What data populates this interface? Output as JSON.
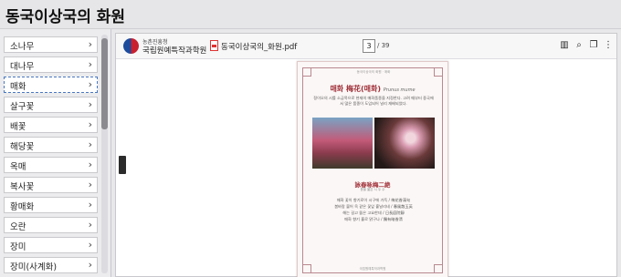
{
  "window": {
    "title": "동국이상국의 화원"
  },
  "sidebar": {
    "items": [
      {
        "label": "소나무"
      },
      {
        "label": "대나무"
      },
      {
        "label": "매화"
      },
      {
        "label": "살구꽃"
      },
      {
        "label": "배꽃"
      },
      {
        "label": "해당꽃"
      },
      {
        "label": "옥매"
      },
      {
        "label": "복사꽃"
      },
      {
        "label": "황매화"
      },
      {
        "label": "오란"
      },
      {
        "label": "장미"
      },
      {
        "label": "장미(사계화)"
      }
    ],
    "selected_index": 2,
    "chevron": "›"
  },
  "viewer": {
    "org_small": "농촌진흥청",
    "org_name": "국립원예특작과학원",
    "filename": "동국이상국의_화원.pdf",
    "page_current": "3",
    "page_total": "/ 39",
    "toolbar_icons": [
      "thumbnails-icon",
      "search-icon",
      "copy-icon",
      "more-icon"
    ]
  },
  "document": {
    "header_line": "동국이상국의 화원 · 매화",
    "title": "매화 梅花(매화)",
    "title_en": "Prunus mume",
    "intro": "정이오의 시를 소금목으로 현재의 매화품종을 지정한다. 고려 때부터 중국에서 많은 품종이 도입되어 널리 재배되었다.",
    "poem_title": "詠春咏梅二絶",
    "poem_subtitle": "봄을 읊은 시 두 수",
    "poem_lines": [
      "매화 꽃이 향기로이 시구에 가득 / 梅花香滿句",
      "봄바람 불어 옥 같은 꽃잎 흩날리네 / 春風散玉英",
      "해는 길고 뜰은 고요한데 / 日長庭院靜",
      "매화 향기 홀로 맑구나 / 獨有暗香淸"
    ],
    "footer": "국립원예특작과학원"
  },
  "colors": {
    "accent": "#a03038",
    "selection_border": "#4a78c2",
    "frame": "#b8888f"
  }
}
